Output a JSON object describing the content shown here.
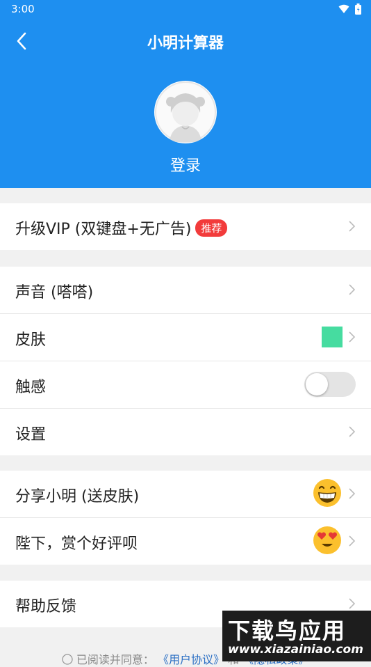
{
  "status_bar": {
    "time": "3:00"
  },
  "header": {
    "title": "小明计算器",
    "login_label": "登录"
  },
  "vip": {
    "label": "升级VIP (双键盘+无广告)",
    "badge": "推荐"
  },
  "settings": {
    "sound_label": "声音 (嗒嗒)",
    "skin_label": "皮肤",
    "skin_color": "#46dca0",
    "haptic_label": "触感",
    "haptic_enabled": false,
    "settings_label": "设置"
  },
  "social": {
    "share_label": "分享小明 (送皮肤)",
    "rate_label": "陛下，赏个好评呗"
  },
  "help": {
    "feedback_label": "帮助反馈"
  },
  "footer": {
    "text": "已阅读并同意：",
    "user_agreement": "《用户协议》",
    "and": "和",
    "privacy_policy": "《隐私政策》"
  },
  "watermark": {
    "title": "下载鸟应用",
    "url": "www.xiazainiao.com"
  },
  "colors": {
    "accent": "#1e8ff0",
    "badge": "#f23b3b",
    "link": "#2a6fc4"
  }
}
